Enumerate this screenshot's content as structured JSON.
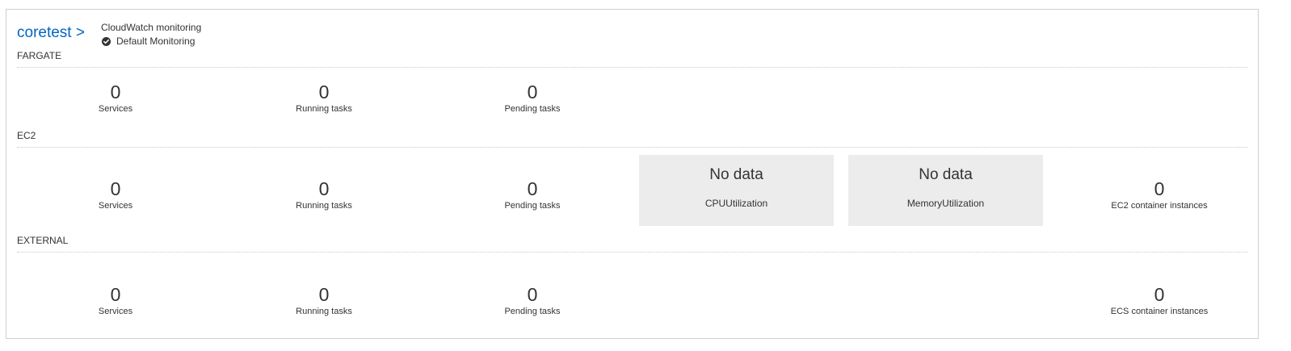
{
  "cluster": {
    "name": "coretest",
    "link_label": "coretest >"
  },
  "monitoring": {
    "title": "CloudWatch monitoring",
    "status": "Default Monitoring"
  },
  "sections": {
    "fargate": {
      "label": "FARGATE",
      "services": {
        "value": "0",
        "label": "Services"
      },
      "running": {
        "value": "0",
        "label": "Running tasks"
      },
      "pending": {
        "value": "0",
        "label": "Pending tasks"
      }
    },
    "ec2": {
      "label": "EC2",
      "services": {
        "value": "0",
        "label": "Services"
      },
      "running": {
        "value": "0",
        "label": "Running tasks"
      },
      "pending": {
        "value": "0",
        "label": "Pending tasks"
      },
      "cpu": {
        "value": "No data",
        "label": "CPUUtilization"
      },
      "memory": {
        "value": "No data",
        "label": "MemoryUtilization"
      },
      "instances": {
        "value": "0",
        "label": "EC2 container instances"
      }
    },
    "external": {
      "label": "EXTERNAL",
      "services": {
        "value": "0",
        "label": "Services"
      },
      "running": {
        "value": "0",
        "label": "Running tasks"
      },
      "pending": {
        "value": "0",
        "label": "Pending tasks"
      },
      "instances": {
        "value": "0",
        "label": "ECS container instances"
      }
    }
  },
  "colors": {
    "link": "#0066c0",
    "tile_bg": "#ececec",
    "border": "#cfcfcf"
  },
  "icons": {
    "status": "check-circle-icon"
  }
}
